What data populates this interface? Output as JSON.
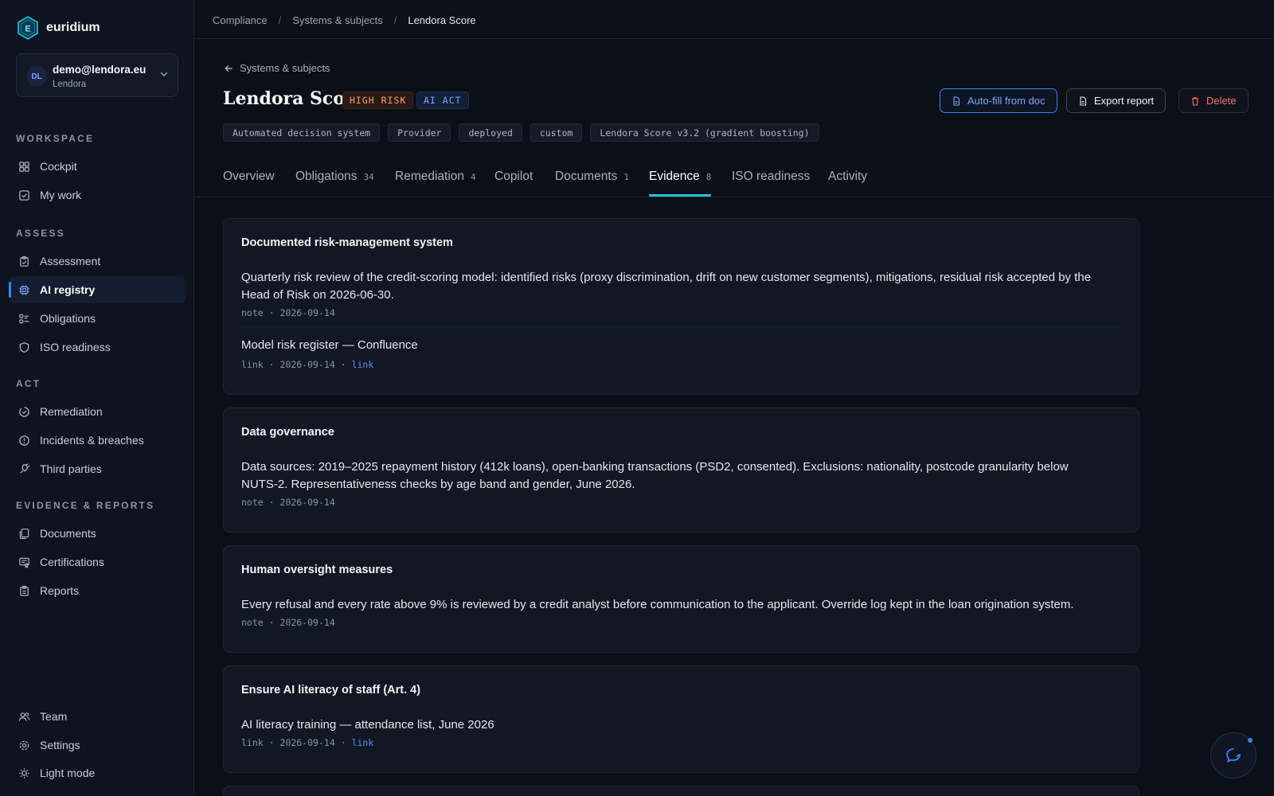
{
  "brand": {
    "name": "euridium",
    "logo_letter": "E"
  },
  "account": {
    "initials": "DL",
    "email": "demo@lendora.eu",
    "org": "Lendora"
  },
  "sidebar": {
    "sections": [
      "WORKSPACE",
      "ASSESS",
      "ACT",
      "EVIDENCE & REPORTS"
    ],
    "items": [
      {
        "label": "Cockpit",
        "icon": "grid-icon"
      },
      {
        "label": "My work",
        "icon": "check-square-icon"
      },
      {
        "label": "Assessment",
        "icon": "clipboard-check-icon"
      },
      {
        "label": "AI registry",
        "icon": "cpu-icon"
      },
      {
        "label": "Obligations",
        "icon": "list-checks-icon"
      },
      {
        "label": "ISO readiness",
        "icon": "shield-icon"
      },
      {
        "label": "Remediation",
        "icon": "circle-dashed-check-icon"
      },
      {
        "label": "Incidents & breaches",
        "icon": "alert-circle-icon"
      },
      {
        "label": "Third parties",
        "icon": "plug-icon"
      },
      {
        "label": "Documents",
        "icon": "files-icon"
      },
      {
        "label": "Certifications",
        "icon": "award-icon"
      },
      {
        "label": "Reports",
        "icon": "clipboard-list-icon"
      }
    ],
    "footer": [
      {
        "label": "Team",
        "icon": "users-icon"
      },
      {
        "label": "Settings",
        "icon": "gear-icon"
      },
      {
        "label": "Light mode",
        "icon": "sun-icon"
      }
    ]
  },
  "breadcrumb": [
    "Compliance",
    "Systems & subjects",
    "Lendora Score"
  ],
  "back_label": "Systems & subjects",
  "system": {
    "name": "Lendora Score",
    "badges": [
      "HIGH RISK",
      "AI ACT"
    ],
    "tags": [
      "Automated decision system",
      "Provider",
      "deployed",
      "custom",
      "Lendora Score v3.2 (gradient boosting)"
    ]
  },
  "actions": {
    "autofill": "Auto-fill from doc",
    "export": "Export report",
    "delete": "Delete"
  },
  "tabs": [
    {
      "label": "Overview",
      "count": ""
    },
    {
      "label": "Obligations",
      "count": "34"
    },
    {
      "label": "Remediation",
      "count": "4"
    },
    {
      "label": "Copilot",
      "count": ""
    },
    {
      "label": "Documents",
      "count": "1"
    },
    {
      "label": "Evidence",
      "count": "8"
    },
    {
      "label": "ISO readiness",
      "count": ""
    },
    {
      "label": "Activity",
      "count": ""
    }
  ],
  "active_tab": "Evidence",
  "evidence_groups": [
    {
      "title": "Documented risk-management system",
      "items": [
        {
          "text": "Quarterly risk review of the credit-scoring model: identified risks (proxy discrimination, drift on new customer segments), mitigations, residual risk accepted by the Head of Risk on 2026-06-30.",
          "type": "note",
          "date": "2026-09-14",
          "link": ""
        },
        {
          "text": "Model risk register — Confluence",
          "type": "link",
          "date": "2026-09-14",
          "link": "link"
        }
      ]
    },
    {
      "title": "Data governance",
      "items": [
        {
          "text": "Data sources: 2019–2025 repayment history (412k loans), open-banking transactions (PSD2, consented). Exclusions: nationality, postcode granularity below NUTS-2. Representativeness checks by age band and gender, June 2026.",
          "type": "note",
          "date": "2026-09-14",
          "link": ""
        }
      ]
    },
    {
      "title": "Human oversight measures",
      "items": [
        {
          "text": "Every refusal and every rate above 9% is reviewed by a credit analyst before communication to the applicant. Override log kept in the loan origination system.",
          "type": "note",
          "date": "2026-09-14",
          "link": ""
        }
      ]
    },
    {
      "title": "Ensure AI literacy of staff (Art. 4)",
      "items": [
        {
          "text": "AI literacy training — attendance list, June 2026",
          "type": "link",
          "date": "2026-09-14",
          "link": "link"
        }
      ]
    }
  ],
  "meta_separator": "·",
  "colors": {
    "accent": "#3b82f6",
    "tab_underline": "#22c3dd",
    "danger": "#f87171",
    "risk": "#f59e6b"
  }
}
